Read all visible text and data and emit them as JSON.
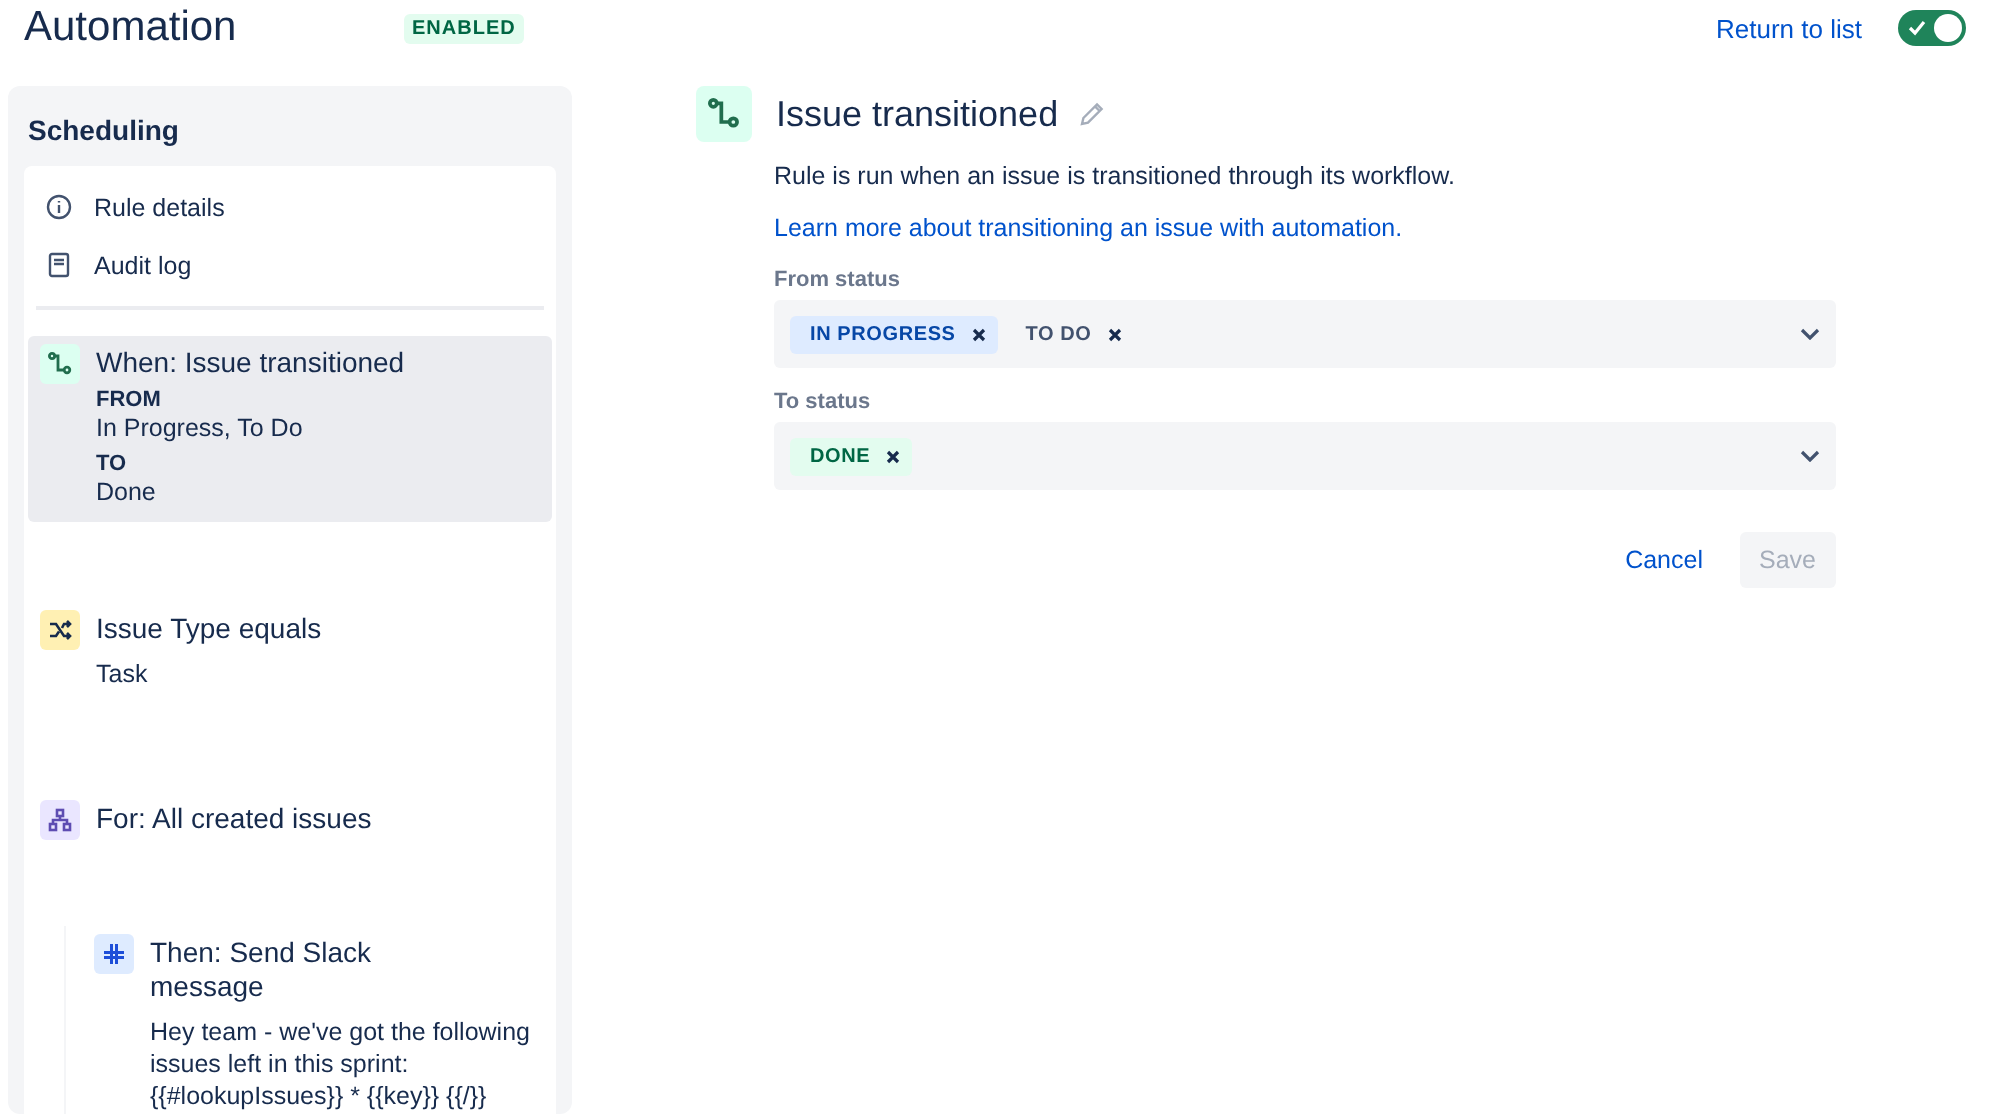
{
  "header": {
    "title": "Automation",
    "status_badge": "ENABLED",
    "return_link": "Return to list",
    "rule_enabled": true
  },
  "sidebar": {
    "title": "Scheduling",
    "links": [
      {
        "kind": "info",
        "label": "Rule details"
      },
      {
        "kind": "log",
        "label": "Audit log"
      }
    ],
    "steps": [
      {
        "kind": "trigger",
        "title": "When: Issue transitioned",
        "selected": true,
        "details": [
          {
            "kind": "heading",
            "text": "FROM"
          },
          {
            "kind": "value",
            "text": "In Progress, To Do"
          },
          {
            "kind": "heading",
            "text": "TO"
          },
          {
            "kind": "value",
            "text": "Done"
          }
        ]
      },
      {
        "kind": "condition",
        "title": "Issue Type equals",
        "selected": false,
        "details": [
          {
            "kind": "value",
            "text": "Task"
          }
        ]
      },
      {
        "kind": "branch",
        "title": "For: All created issues",
        "selected": false,
        "children": [
          {
            "kind": "action",
            "title": "Then: Send Slack message",
            "selected": false,
            "details": [
              {
                "kind": "value",
                "text": "Hey team - we've got the following issues left in this sprint: {{#lookupIssues}} * {{key}} {{/}}"
              }
            ]
          }
        ]
      }
    ]
  },
  "panel": {
    "title": "Issue transitioned",
    "description": "Rule is run when an issue is transitioned through its workflow.",
    "learn_link": "Learn more about transitioning an issue with automation.",
    "fields": [
      {
        "label": "From status",
        "tags": [
          {
            "text": "IN PROGRESS",
            "kind": "inprogress"
          },
          {
            "text": "TO DO",
            "kind": "todo"
          }
        ]
      },
      {
        "label": "To status",
        "tags": [
          {
            "text": "DONE",
            "kind": "done"
          }
        ]
      }
    ],
    "buttons": [
      {
        "label": "Cancel",
        "kind": "link",
        "disabled": false
      },
      {
        "label": "Save",
        "kind": "primary",
        "disabled": true
      }
    ]
  }
}
